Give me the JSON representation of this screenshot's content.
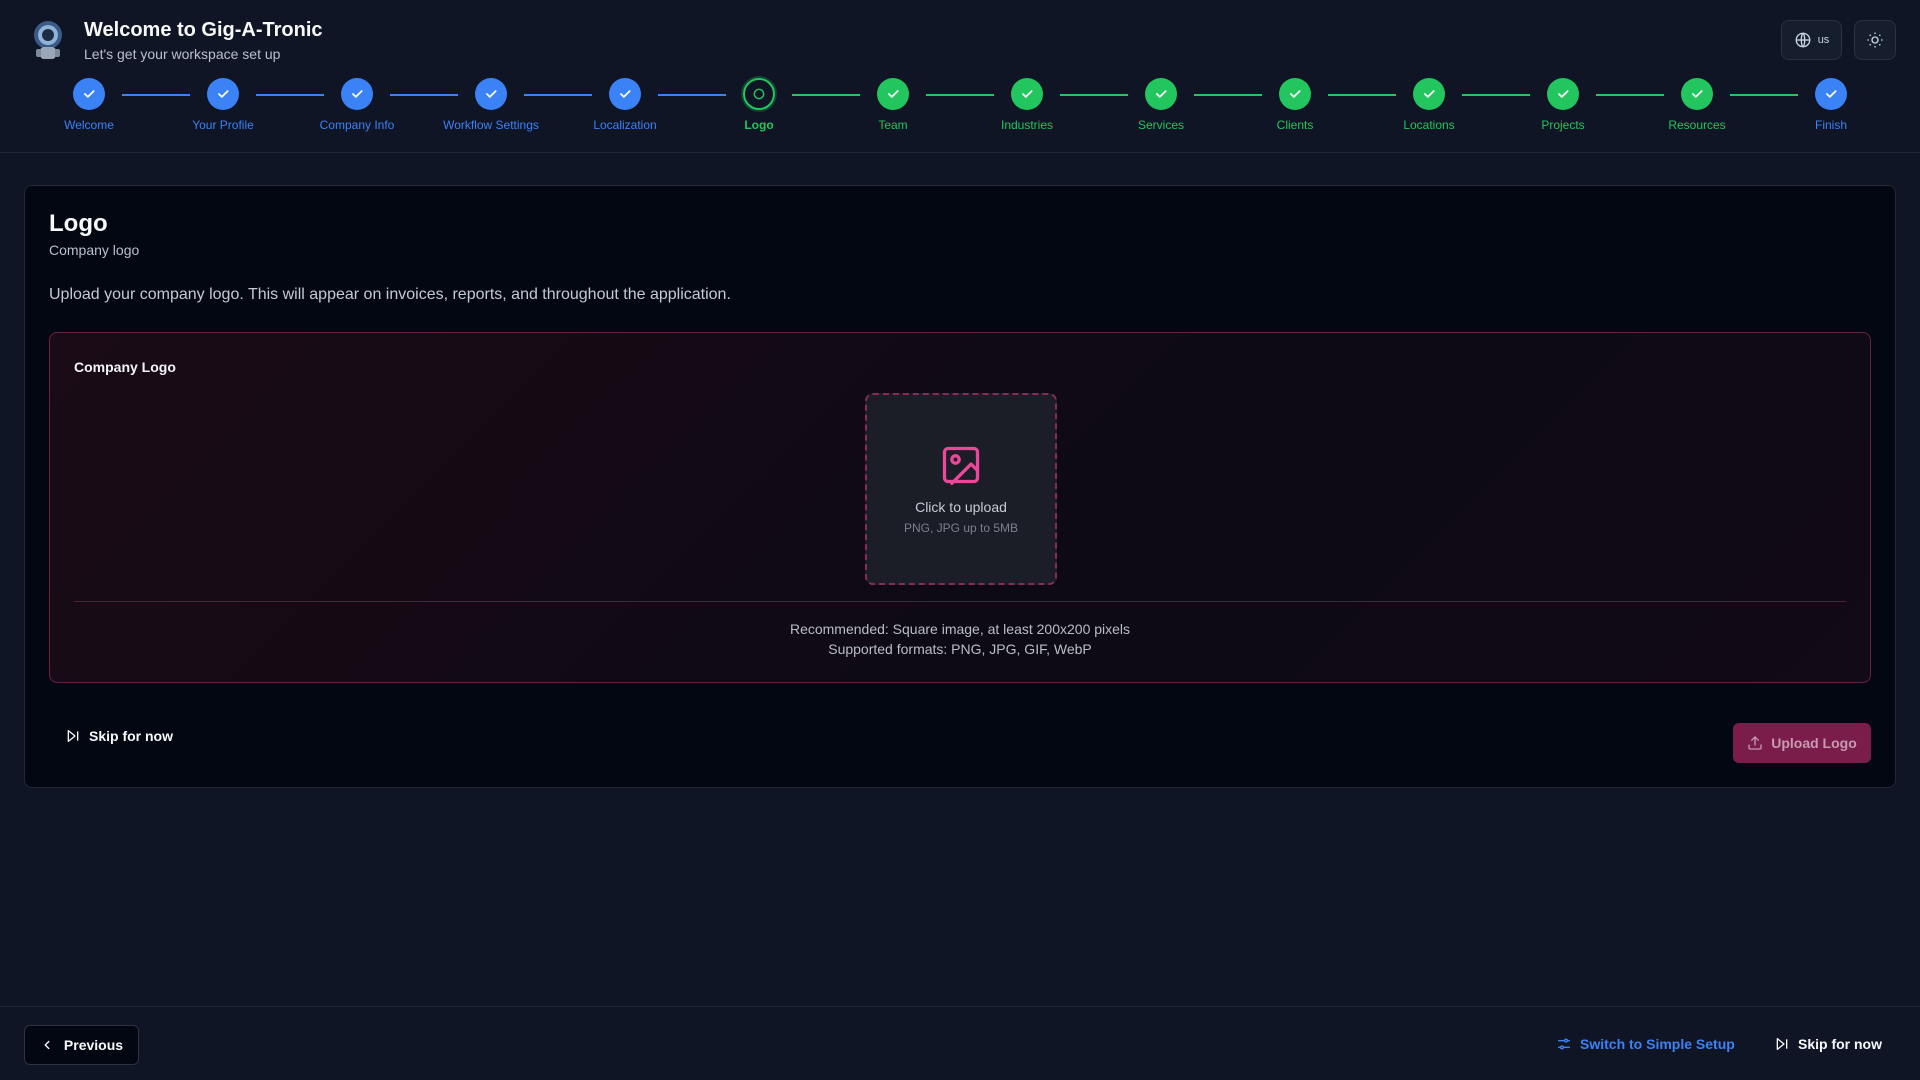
{
  "app": {
    "title": "Welcome to Gig-A-Tronic",
    "subtitle": "Let's get your workspace set up"
  },
  "top_actions": {
    "language_code": "us",
    "language_icon": "globe-icon",
    "theme_icon": "sun-icon"
  },
  "colors": {
    "completed_blue": "#3b82f6",
    "completed_green": "#22c55e",
    "accent_pink": "#ec4899",
    "background": "#0f1524"
  },
  "stepper": {
    "steps": [
      {
        "label": "Welcome",
        "state": "done-blue"
      },
      {
        "label": "Your Profile",
        "state": "done-blue"
      },
      {
        "label": "Company Info",
        "state": "done-blue"
      },
      {
        "label": "Workflow Settings",
        "state": "done-blue"
      },
      {
        "label": "Localization",
        "state": "done-blue"
      },
      {
        "label": "Logo",
        "state": "current"
      },
      {
        "label": "Team",
        "state": "done-green"
      },
      {
        "label": "Industries",
        "state": "done-green"
      },
      {
        "label": "Services",
        "state": "done-green"
      },
      {
        "label": "Clients",
        "state": "done-green"
      },
      {
        "label": "Locations",
        "state": "done-green"
      },
      {
        "label": "Projects",
        "state": "done-green"
      },
      {
        "label": "Resources",
        "state": "done-green"
      },
      {
        "label": "Finish",
        "state": "done-blue"
      }
    ]
  },
  "card": {
    "title": "Logo",
    "subtitle": "Company logo",
    "description": "Upload your company logo. This will appear on invoices, reports, and throughout the application.",
    "panel_label": "Company Logo",
    "dropzone_text": "Click to upload",
    "dropzone_hint": "PNG, JPG up to 5MB",
    "recommend_line1": "Recommended: Square image, at least 200x200 pixels",
    "recommend_line2": "Supported formats: PNG, JPG, GIF, WebP",
    "skip_label": "Skip for now",
    "upload_label": "Upload Logo"
  },
  "footer": {
    "previous_label": "Previous",
    "switch_label": "Switch to Simple Setup",
    "skip_label": "Skip for now"
  }
}
